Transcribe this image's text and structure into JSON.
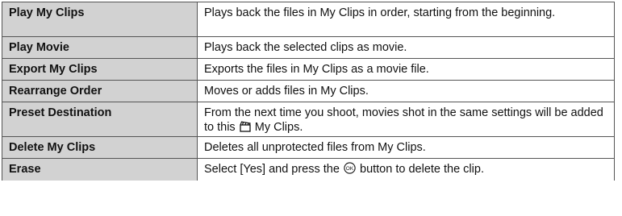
{
  "table": {
    "rows": [
      {
        "name": "Play My Clips",
        "desc": "Plays back the files in My Clips in order, starting from the beginning."
      },
      {
        "name": "Play Movie",
        "desc": "Plays back the selected clips as movie."
      },
      {
        "name": "Export My Clips",
        "desc": "Exports the files in My Clips as a movie file."
      },
      {
        "name": "Rearrange Order",
        "desc": "Moves or adds files in My Clips."
      },
      {
        "name": "Preset Destination",
        "desc_before": "From the next time you shoot, movies shot in the same settings will be added to this",
        "desc_after": "My Clips.",
        "icon": "clapperboard-icon"
      },
      {
        "name": "Delete My Clips",
        "desc": "Deletes all unprotected files from My Clips."
      },
      {
        "name": "Erase",
        "desc_before": "Select [Yes] and press the",
        "desc_after": "button to delete the clip.",
        "icon": "ok-button-icon"
      }
    ]
  }
}
